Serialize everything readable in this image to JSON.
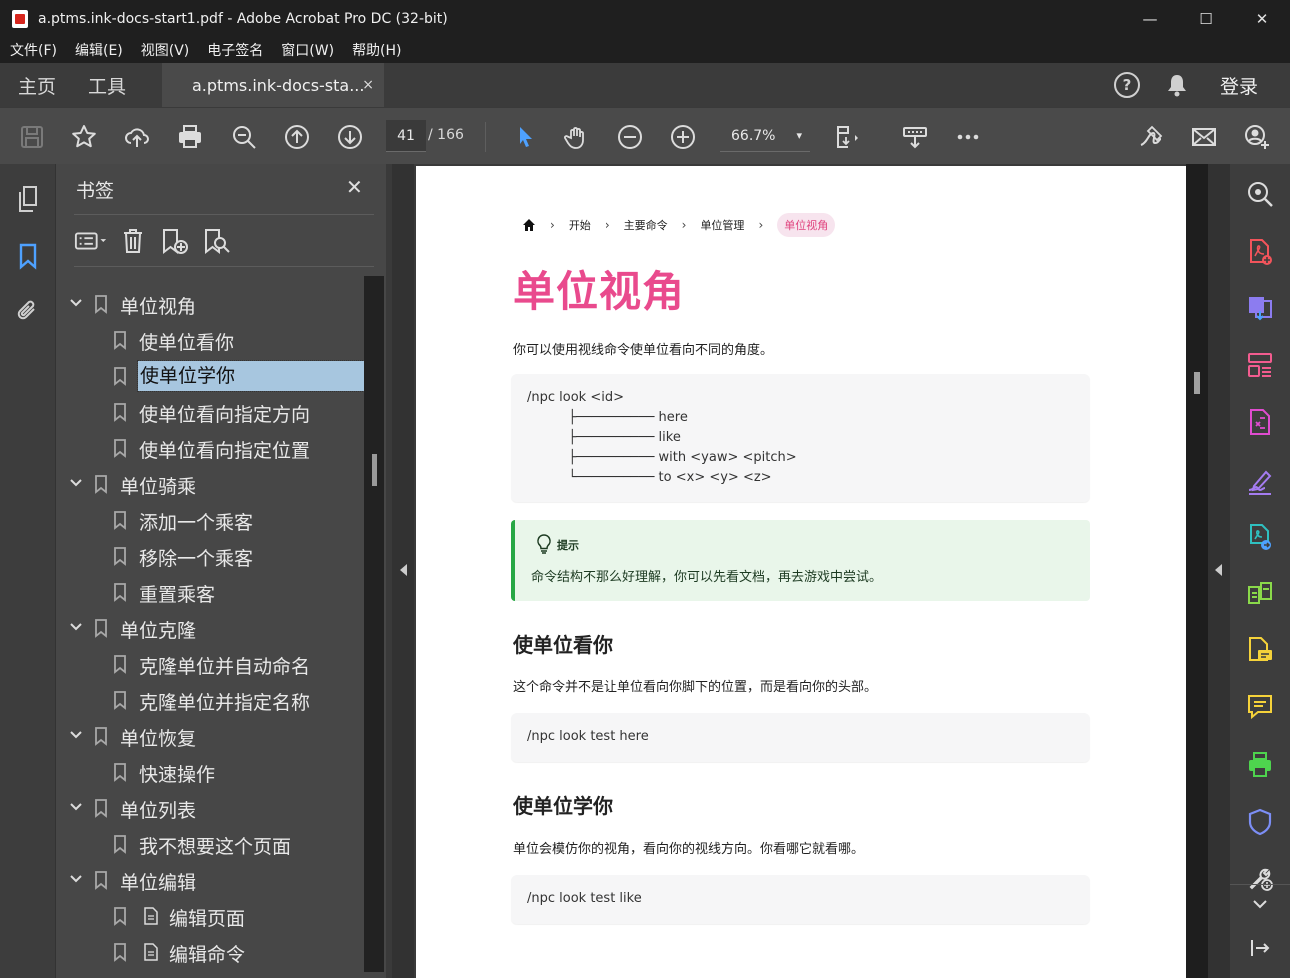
{
  "window": {
    "title": "a.ptms.ink-docs-start1.pdf - Adobe Acrobat Pro DC (32-bit)",
    "minimize": "—",
    "maximize": "☐",
    "close": "✕"
  },
  "menu": [
    "文件(F)",
    "编辑(E)",
    "视图(V)",
    "电子签名",
    "窗口(W)",
    "帮助(H)"
  ],
  "tabs": {
    "home": "主页",
    "tools": "工具",
    "document": "a.ptms.ink-docs-sta...",
    "document_close": "×",
    "help": "?",
    "login": "登录"
  },
  "toolbar": {
    "current_page": "41",
    "total_pages": "/ 166",
    "zoom": "66.7%",
    "zoom_caret": "▾"
  },
  "bookmarks": {
    "header": "书签",
    "close": "✕",
    "items": [
      {
        "label": "单位视角",
        "level": 0,
        "expanded": true
      },
      {
        "label": "使单位看你",
        "level": 1
      },
      {
        "label": "使单位学你",
        "level": 1,
        "selected": true
      },
      {
        "label": "使单位看向指定方向",
        "level": 1
      },
      {
        "label": "使单位看向指定位置",
        "level": 1
      },
      {
        "label": "单位骑乘",
        "level": 0,
        "expanded": true
      },
      {
        "label": "添加一个乘客",
        "level": 1
      },
      {
        "label": "移除一个乘客",
        "level": 1
      },
      {
        "label": "重置乘客",
        "level": 1
      },
      {
        "label": "单位克隆",
        "level": 0,
        "expanded": true
      },
      {
        "label": "克隆单位并自动命名",
        "level": 1
      },
      {
        "label": "克隆单位并指定名称",
        "level": 1
      },
      {
        "label": "单位恢复",
        "level": 0,
        "expanded": true
      },
      {
        "label": "快速操作",
        "level": 1
      },
      {
        "label": "单位列表",
        "level": 0,
        "expanded": true
      },
      {
        "label": "我不想要这个页面",
        "level": 1
      },
      {
        "label": "单位编辑",
        "level": 0,
        "expanded": true
      },
      {
        "label": "编辑页面",
        "level": 1,
        "doc": true
      },
      {
        "label": "编辑命令",
        "level": 1,
        "doc": true
      }
    ]
  },
  "doc": {
    "breadcrumb": [
      "开始",
      "主要命令",
      "单位管理"
    ],
    "breadcrumb_sep": "›",
    "breadcrumb_current": "单位视角",
    "title": "单位视角",
    "intro": "你可以使用视线命令使单位看向不同的角度。",
    "code1": [
      "/npc look <id>",
      "          ├────────── here",
      "          ├────────── like",
      "          ├────────── with <yaw> <pitch>",
      "          └────────── to <x> <y> <z>"
    ],
    "tip_title": "提示",
    "tip_text": "命令结构不那么好理解，你可以先看文档，再去游戏中尝试。",
    "h2_1": "使单位看你",
    "p1": "这个命令并不是让单位看向你脚下的位置，而是看向你的头部。",
    "code2": "/npc look test here",
    "h2_2": "使单位学你",
    "p2": "单位会模仿你的视角，看向你的视线方向。你看哪它就看哪。",
    "code3": "/npc look test like"
  },
  "colors": {
    "accent_pink": "#e94a8d",
    "selected_bookmark": "#a7c6df",
    "tip_green": "#28a745",
    "tool_blue": "#4ea1ff"
  }
}
